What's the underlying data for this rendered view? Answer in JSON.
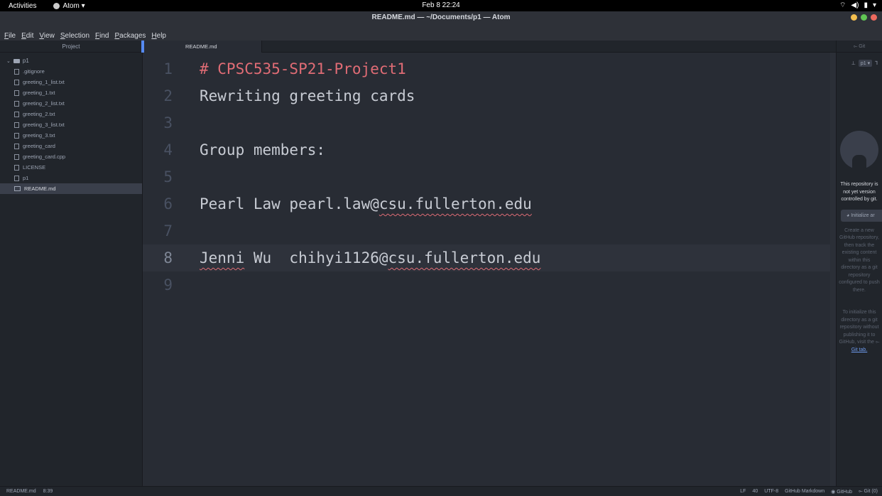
{
  "topbar": {
    "activities": "Activities",
    "app_menu": "Atom ▾",
    "clock": "Feb 8  22:24",
    "tray": {
      "wifi": "⌔",
      "volume": "◀)",
      "battery": "▮",
      "menu": "▾"
    }
  },
  "window": {
    "title": "README.md — ~/Documents/p1 — Atom",
    "buttons": {
      "minimize_color": "#f4bf4f",
      "maximize_color": "#61c554",
      "close_color": "#ed6a5e"
    }
  },
  "menubar": [
    {
      "label": "File",
      "accel": "F",
      "rest": "ile"
    },
    {
      "label": "Edit",
      "accel": "E",
      "rest": "dit"
    },
    {
      "label": "View",
      "accel": "V",
      "rest": "iew"
    },
    {
      "label": "Selection",
      "accel": "S",
      "rest": "election"
    },
    {
      "label": "Find",
      "accel": "F",
      "rest": "ind"
    },
    {
      "label": "Packages",
      "accel": "P",
      "rest": "ackages"
    },
    {
      "label": "Help",
      "accel": "H",
      "rest": "elp"
    }
  ],
  "treeview": {
    "header": "Project",
    "root": "p1",
    "files": [
      ".gitignore",
      "greeting_1_list.txt",
      "greeting_1.txt",
      "greeting_2_list.txt",
      "greeting_2.txt",
      "greeting_3_list.txt",
      "greeting_3.txt",
      "greeting_card",
      "greeting_card.cpp",
      "LICENSE",
      "p1",
      "README.md"
    ],
    "selected": "README.md"
  },
  "tabs": [
    {
      "label": "README.md",
      "active": true
    }
  ],
  "editor": {
    "lines": [
      {
        "n": "1",
        "text": "# CPSC535-SP21-Project1"
      },
      {
        "n": "2",
        "text": "Rewriting greeting cards"
      },
      {
        "n": "3",
        "text": ""
      },
      {
        "n": "4",
        "text": "Group members:"
      },
      {
        "n": "5",
        "text": ""
      },
      {
        "n": "6",
        "text": "Pearl Law pearl.law@csu.fullerton.edu"
      },
      {
        "n": "7",
        "text": ""
      },
      {
        "n": "8",
        "text": "Jenni Wu  chihyi1126@csu.fullerton.edu"
      },
      {
        "n": "9",
        "text": ""
      }
    ],
    "active_line": "8",
    "line6": {
      "prefix": "Pearl Law pearl.law@",
      "misspelled": "csu.fullerton.edu"
    },
    "line8": {
      "name": "Jenni",
      "space": " Wu  chihyi1126@",
      "misspelled": "csu.fullerton.edu"
    }
  },
  "git_panel": {
    "tab": "⟜ Git",
    "branch_prefix": "⊥",
    "branch": "p1 ▾",
    "branch_icon": "⅂",
    "not_versioned": "This repository is not yet version controlled by git.",
    "init_button": "Initialize ar",
    "create_msg": "Create a new GitHub repository, then track the existing content within this directory as a git repository configured to push there.",
    "init_msg": "To initialize this directory as a git repository without publishing it to GitHub, visit the",
    "git_tab_link": "Git tab."
  },
  "statusbar": {
    "file": "README.md",
    "cursor": "8:39",
    "line_ending": "LF",
    "tabs": "40",
    "encoding": "UTF-8",
    "grammar": "GitHub Markdown",
    "github": "GitHub",
    "git": "Git (0)"
  }
}
